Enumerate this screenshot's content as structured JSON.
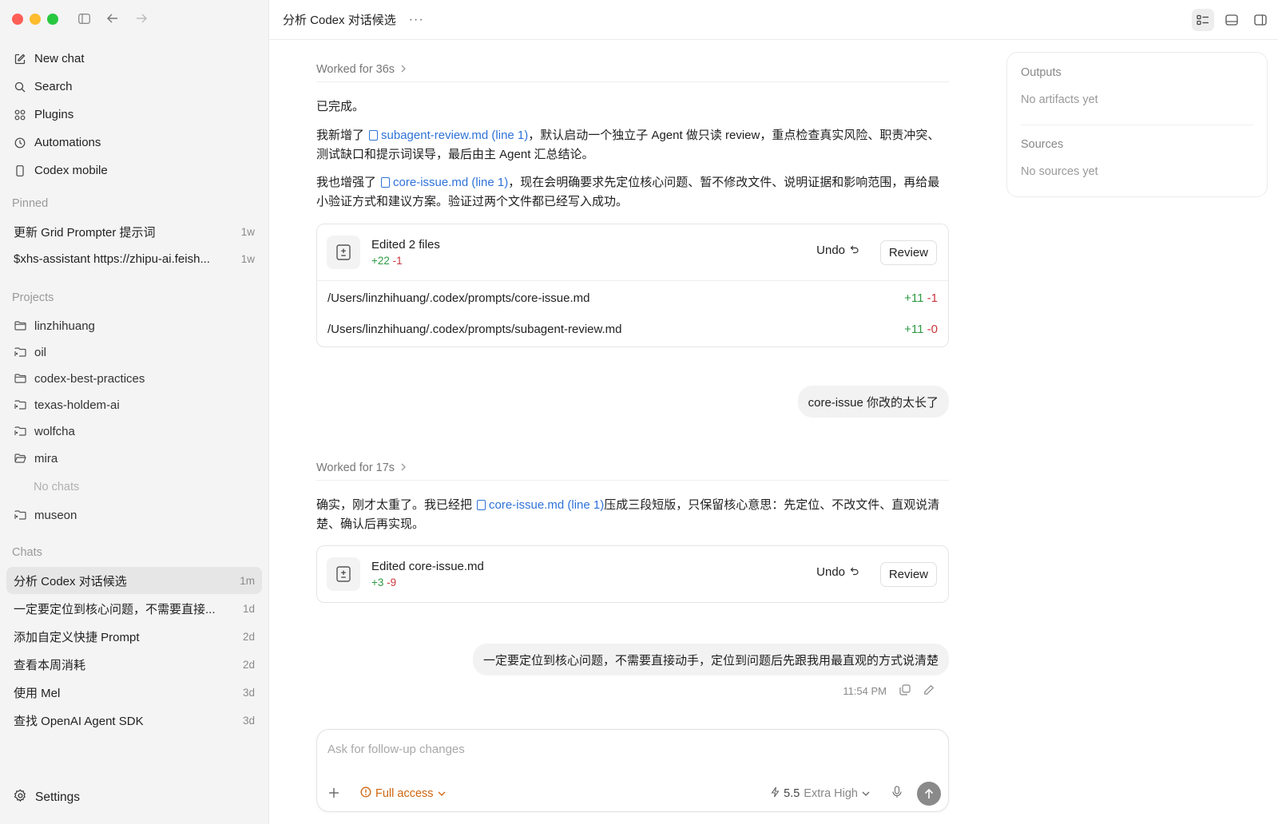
{
  "sidebar": {
    "nav": [
      {
        "label": "New chat",
        "icon": "compose-icon"
      },
      {
        "label": "Search",
        "icon": "search-icon"
      },
      {
        "label": "Plugins",
        "icon": "plugins-icon"
      },
      {
        "label": "Automations",
        "icon": "clock-icon"
      },
      {
        "label": "Codex mobile",
        "icon": "phone-icon"
      }
    ],
    "pinned_label": "Pinned",
    "pinned": [
      {
        "title": "更新 Grid Prompter 提示词",
        "ago": "1w"
      },
      {
        "title": "$xhs-assistant https://zhipu-ai.feish...",
        "ago": "1w"
      }
    ],
    "projects_label": "Projects",
    "projects": [
      "linzhihuang",
      "oil",
      "codex-best-practices",
      "texas-holdem-ai",
      "wolfcha",
      "mira",
      "museon"
    ],
    "no_chats": "No chats",
    "chats_label": "Chats",
    "chats": [
      {
        "title": "分析 Codex 对话候选",
        "ago": "1m"
      },
      {
        "title": "一定要定位到核心问题，不需要直接...",
        "ago": "1d"
      },
      {
        "title": "添加自定义快捷 Prompt",
        "ago": "2d"
      },
      {
        "title": "查看本周消耗",
        "ago": "2d"
      },
      {
        "title": "使用 Mel",
        "ago": "3d"
      },
      {
        "title": "查找 OpenAI Agent SDK",
        "ago": "3d"
      }
    ],
    "settings": "Settings"
  },
  "header": {
    "title": "分析 Codex 对话候选",
    "more": "···"
  },
  "thread": {
    "worked1": "Worked for 36s",
    "done": "已完成。",
    "p1_pre": "我新增了",
    "p1_link": "subagent-review.md (line 1)",
    "p1_post": "，默认启动一个独立子 Agent 做只读 review，重点检查真实风险、职责冲突、测试缺口和提示词误导，最后由主 Agent 汇总结论。",
    "p2_pre": "我也增强了",
    "p2_link": "core-issue.md (line 1)",
    "p2_post": "，现在会明确要求先定位核心问题、暂不修改文件、说明证据和影响范围，再给最小验证方式和建议方案。验证过两个文件都已经写入成功。",
    "card1": {
      "title": "Edited 2 files",
      "add": "+22",
      "del": "-1",
      "undo": "Undo",
      "review": "Review",
      "files": [
        {
          "path": "/Users/linzhihuang/.codex/prompts/core-issue.md",
          "add": "+11",
          "del": "-1"
        },
        {
          "path": "/Users/linzhihuang/.codex/prompts/subagent-review.md",
          "add": "+11",
          "del": "-0"
        }
      ]
    },
    "user1": "core-issue 你改的太长了",
    "worked2": "Worked for 17s",
    "p3_pre": "确实，刚才太重了。我已经把",
    "p3_link": "core-issue.md (line 1)",
    "p3_post": "压成三段短版，只保留核心意思：先定位、不改文件、直观说清楚、确认后再实现。",
    "card2": {
      "title": "Edited core-issue.md",
      "add": "+3",
      "del": "-9",
      "undo": "Undo",
      "review": "Review"
    },
    "user2": "一定要定位到核心问题，不需要直接动手，定位到问题后先跟我用最直观的方式说清楚",
    "time": "11:54 PM"
  },
  "composer": {
    "placeholder": "Ask for follow-up changes",
    "access": "Full access",
    "model": "5.5",
    "level": "Extra High"
  },
  "panel": {
    "outputs": "Outputs",
    "outputs_empty": "No artifacts yet",
    "sources": "Sources",
    "sources_empty": "No sources yet"
  },
  "colors": {
    "accent_link": "#2f73d8",
    "add": "#2e9a45",
    "del": "#c9363d",
    "access": "#d0650f"
  }
}
